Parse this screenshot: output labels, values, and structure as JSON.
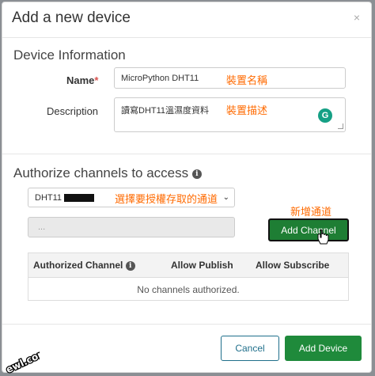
{
  "dialog": {
    "title": "Add a new device",
    "close_glyph": "×"
  },
  "device_info": {
    "section_title": "Device Information",
    "name_label": "Name",
    "required_mark": "*",
    "name_value": "MicroPython DHT11",
    "name_annotation": "裝置名稱",
    "description_label": "Description",
    "description_value": "讀寫DHT11溫濕度資料",
    "description_annotation": "裝置描述",
    "grammarly_letter": "G"
  },
  "authorize": {
    "section_title": "Authorize channels to access",
    "info_glyph": "i",
    "select_value": "DHT11",
    "select_annotation": "選擇要授權存取的通道",
    "chevron_glyph": "⌄",
    "disabled_placeholder": "...",
    "add_channel_annotation": "新增通道",
    "add_channel_label": "Add Channel",
    "table": {
      "headers": [
        "Authorized Channel",
        "Allow Publish",
        "Allow Subscribe"
      ],
      "empty_message": "No channels authorized."
    }
  },
  "footer": {
    "cancel_label": "Cancel",
    "add_device_label": "Add Device"
  },
  "colors": {
    "accent_green": "#1f8a3b",
    "annotation_orange": "#ff6a00",
    "outline_blue": "#1f6f8b"
  }
}
